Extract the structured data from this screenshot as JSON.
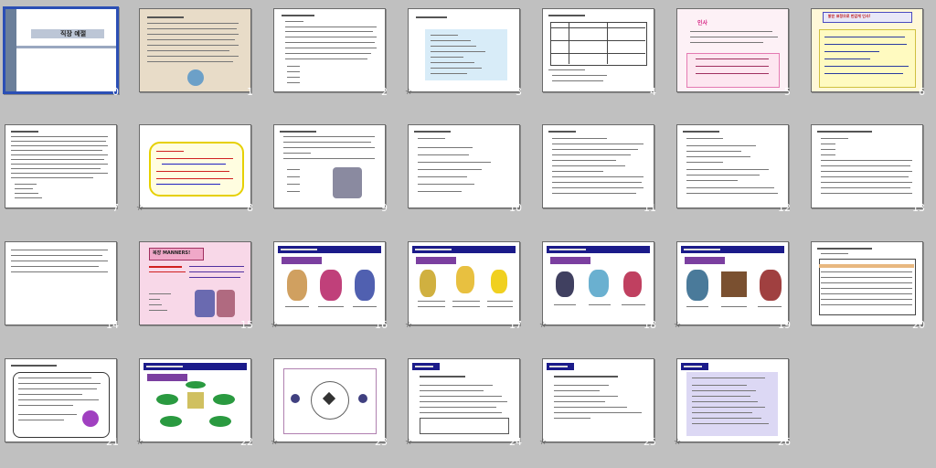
{
  "slides": [
    {
      "n": "0",
      "title": "직장 예절",
      "selected": true
    },
    {
      "n": "1"
    },
    {
      "n": "2"
    },
    {
      "n": "3",
      "anim": true
    },
    {
      "n": "4"
    },
    {
      "n": "5",
      "heading": "인사"
    },
    {
      "n": "6",
      "heading": "밝은 표정으로 반갑게 인사!"
    },
    {
      "n": "7"
    },
    {
      "n": "8",
      "anim": true
    },
    {
      "n": "9"
    },
    {
      "n": "10"
    },
    {
      "n": "11"
    },
    {
      "n": "12"
    },
    {
      "n": "13"
    },
    {
      "n": "14"
    },
    {
      "n": "15",
      "heading": "복장 MANNERS!"
    },
    {
      "n": "16",
      "anim": true
    },
    {
      "n": "17",
      "anim": true
    },
    {
      "n": "18",
      "anim": true
    },
    {
      "n": "19",
      "anim": true
    },
    {
      "n": "20"
    },
    {
      "n": "21"
    },
    {
      "n": "22",
      "anim": true
    },
    {
      "n": "23",
      "anim": true
    },
    {
      "n": "24",
      "anim": true
    },
    {
      "n": "25",
      "anim": true
    },
    {
      "n": "26",
      "anim": true
    }
  ],
  "anim_icon": "star-icon",
  "colors": {
    "selection": "#2b4fb5",
    "background": "#c0c0c0"
  }
}
